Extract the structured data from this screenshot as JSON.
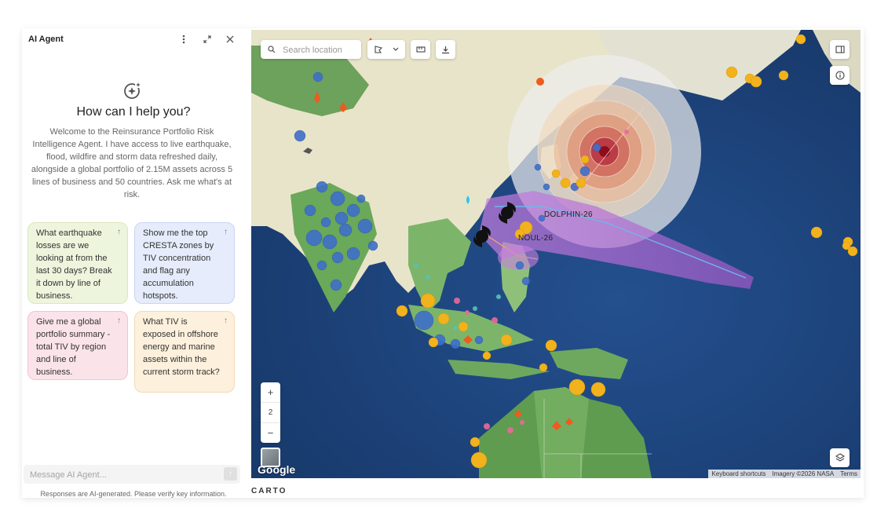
{
  "panel": {
    "title": "AI Agent",
    "heading": "How can I help you?",
    "welcome": "Welcome to the Reinsurance Portfolio Risk Intelligence Agent. I have access to live earthquake, flood, wildfire and storm data refreshed daily, alongside a global portfolio of 2.15M assets across 5 lines of business and 50 countries. Ask me what's at risk.",
    "suggestions": [
      {
        "text": "What earthquake losses are we looking at from the last 30 days? Break it down by line of business.",
        "color": "green"
      },
      {
        "text": "Show me the top CRESTA zones by TIV concentration and flag any accumulation hotspots.",
        "color": "blue"
      },
      {
        "text": "Give me a global portfolio summary - total TIV by region and line of business.",
        "color": "pink"
      },
      {
        "text": "What TIV is exposed in offshore energy and marine assets within the current storm track?",
        "color": "yellow"
      }
    ],
    "message_placeholder": "Message AI Agent...",
    "disclaimer": "Responses are AI-generated. Please verify key information."
  },
  "map": {
    "search_placeholder": "Search location",
    "zoom_in": "+",
    "zoom_level": "2",
    "zoom_out": "−",
    "storms": [
      "DOLPHIN-26",
      "NOUL-26"
    ],
    "google_label": "Google",
    "attribution": [
      "Keyboard shortcuts",
      "Imagery ©2026 NASA",
      "Terms"
    ],
    "footer_logo": "CARTO",
    "colors": {
      "asset_blue": "#3f6fc9",
      "asset_orange": "#f2b21c",
      "storm_track": "#b56fd8",
      "quake_center": "#c0172a",
      "wildfire": "#ef5a1f"
    }
  }
}
